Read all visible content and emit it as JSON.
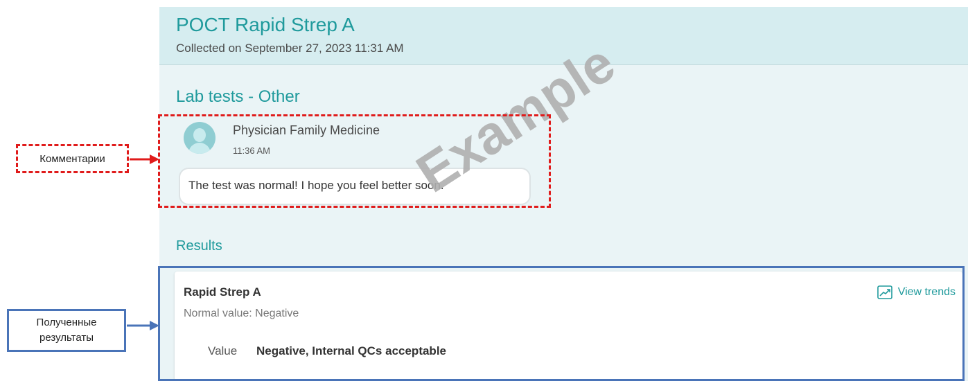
{
  "header": {
    "title": "POCT Rapid Strep A",
    "subtitle": "Collected on September 27, 2023 11:31 AM"
  },
  "comments_section": {
    "title": "Lab tests - Other",
    "comment": {
      "author": "Physician Family Medicine",
      "time": "11:36 AM",
      "text": "The test was normal! I hope you feel better soon."
    }
  },
  "watermark": "Example",
  "results_section": {
    "title": "Results",
    "test_name": "Rapid Strep A",
    "normal_value": "Normal value: Negative",
    "value_label": "Value",
    "value": "Negative, Internal QCs acceptable",
    "view_trends": "View trends"
  },
  "annotations": {
    "comments_label": "Комментарии",
    "results_label": "Полученные\nрезультаты",
    "comments_color": "#e01b1b",
    "results_color": "#4a74b8"
  },
  "colors": {
    "accent": "#1f9a9c",
    "header_bg": "#d6edf0",
    "panel_bg": "#eaf4f6"
  }
}
